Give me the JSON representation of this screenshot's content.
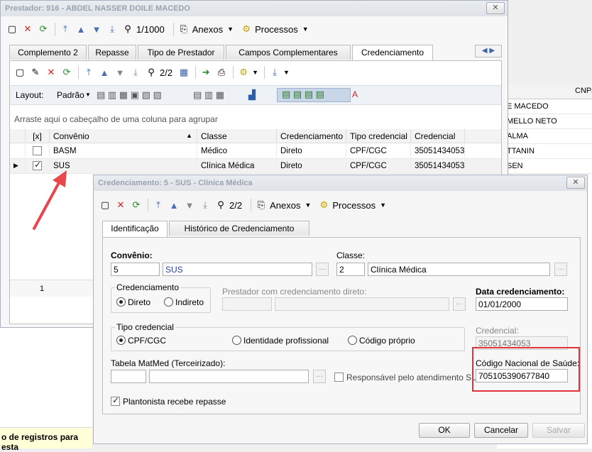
{
  "background_window": {
    "col_header": "CNPJ",
    "rows": [
      "E MACEDO",
      "MELLO NETO",
      "ALMA",
      "TTANIN",
      "SEN"
    ],
    "status_text": "o de registros para esta"
  },
  "prestador_window": {
    "title": "Prestador: 916 - ABDEL NASSER DOILE MACEDO",
    "close_label": "✕",
    "record_count": "1/1000",
    "anexos_label": "Anexos",
    "processos_label": "Processos",
    "tabs": [
      {
        "label": "Complemento 2"
      },
      {
        "label": "Repasse"
      },
      {
        "label": "Tipo de Prestador"
      },
      {
        "label": "Campos Complementares"
      },
      {
        "label": "Credenciamento"
      }
    ],
    "inner_record_count": "2/2",
    "layout_label": "Layout:",
    "layout_value": "Padrão",
    "group_hint": "Arraste aqui o cabeçalho de uma coluna para agrupar",
    "grid": {
      "columns": [
        "[x]",
        "Convênio",
        "Classe",
        "Credenciamento",
        "Tipo credencial",
        "Credencial"
      ],
      "rows": [
        {
          "checked": false,
          "convenio": "BASM",
          "classe": "Médico",
          "credenciamento": "Direto",
          "tipo": "CPF/CGC",
          "credencial": "35051434053"
        },
        {
          "checked": true,
          "convenio": "SUS",
          "classe": "Clínica Médica",
          "credenciamento": "Direto",
          "tipo": "CPF/CGC",
          "credencial": "35051434053"
        }
      ],
      "footer_count": "1"
    }
  },
  "cred_window": {
    "title": "Credenciamento: 5 - SUS - Clínica Médica",
    "close_label": "✕",
    "record_count": "2/2",
    "anexos_label": "Anexos",
    "processos_label": "Processos",
    "tabs": [
      {
        "label": "Identificação"
      },
      {
        "label": "Histórico de Credenciamento"
      }
    ],
    "convenio_label": "Convênio:",
    "convenio_code": "5",
    "convenio_name": "SUS",
    "classe_label": "Classe:",
    "classe_code": "2",
    "classe_name": "Clínica Médica",
    "credenciamento_group": "Credenciamento",
    "radio_direto": "Direto",
    "radio_indireto": "Indireto",
    "prestador_direto_label": "Prestador com credenciamento direto:",
    "data_label": "Data credenciamento:",
    "data_value": "01/01/2000",
    "tipo_group": "Tipo credencial",
    "radio_cpf": "CPF/CGC",
    "radio_identidade": "Identidade profissional",
    "radio_codigo": "Código próprio",
    "credencial_label": "Credencial:",
    "credencial_value": "35051434053",
    "matmed_label": "Tabela MatMed (Terceirizado):",
    "responsavel_label": "Responsável pelo atendimento SUS",
    "cns_label": "Código Nacional de Saúde:",
    "cns_value": "705105390677840",
    "plantonista_label": "Plantonista recebe repasse",
    "ok_label": "OK",
    "cancelar_label": "Cancelar",
    "salvar_label": "Salvar"
  },
  "colors": {
    "highlight": "#e0343a",
    "arrow": "#e8474b"
  }
}
